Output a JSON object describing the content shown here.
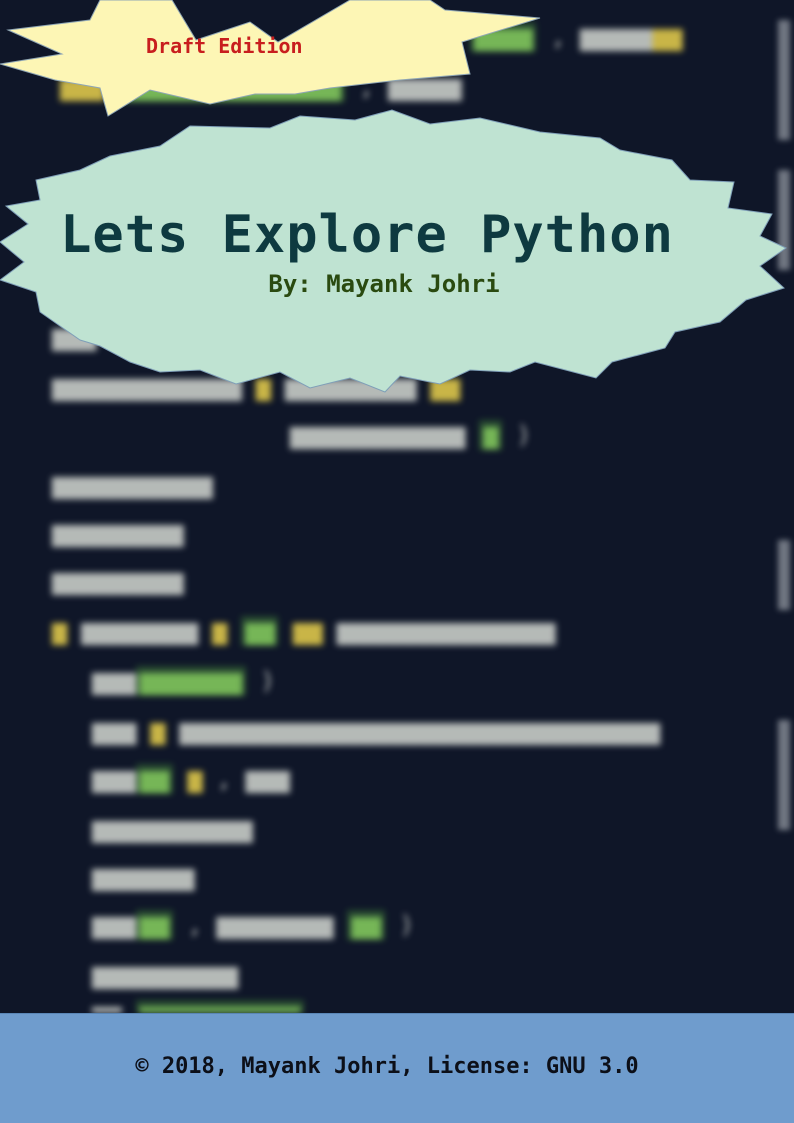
{
  "cover": {
    "badge": "Draft Edition",
    "title": "Lets Explore Python",
    "author": "By: Mayank Johri",
    "footer": "© 2018, Mayank Johri, License: GNU 3.0"
  },
  "colors": {
    "background": "#0f1628",
    "draft_burst": "#fdf6b5",
    "title_burst": "#bfe3d2",
    "draft_text": "#c81e1e",
    "title_text": "#0e3a40",
    "author_text": "#2a4a10",
    "footer_band": "#6f9ccd"
  }
}
